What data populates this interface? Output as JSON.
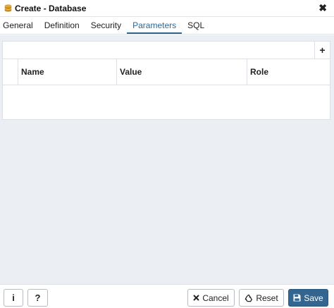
{
  "dialog": {
    "title": "Create - Database",
    "close_glyph": "✖",
    "title_icon": "database-icon"
  },
  "tabs": [
    {
      "label": "General"
    },
    {
      "label": "Definition"
    },
    {
      "label": "Security"
    },
    {
      "label": "Parameters",
      "active": true
    },
    {
      "label": "SQL"
    }
  ],
  "grid": {
    "add_glyph": "+",
    "columns": [
      "Name",
      "Value",
      "Role"
    ],
    "rows": []
  },
  "footer": {
    "info_label": "i",
    "help_label": "?",
    "cancel_label": "Cancel",
    "reset_label": "Reset",
    "save_label": "Save"
  },
  "colors": {
    "accent": "#326690",
    "content_bg": "#ebeef3"
  }
}
